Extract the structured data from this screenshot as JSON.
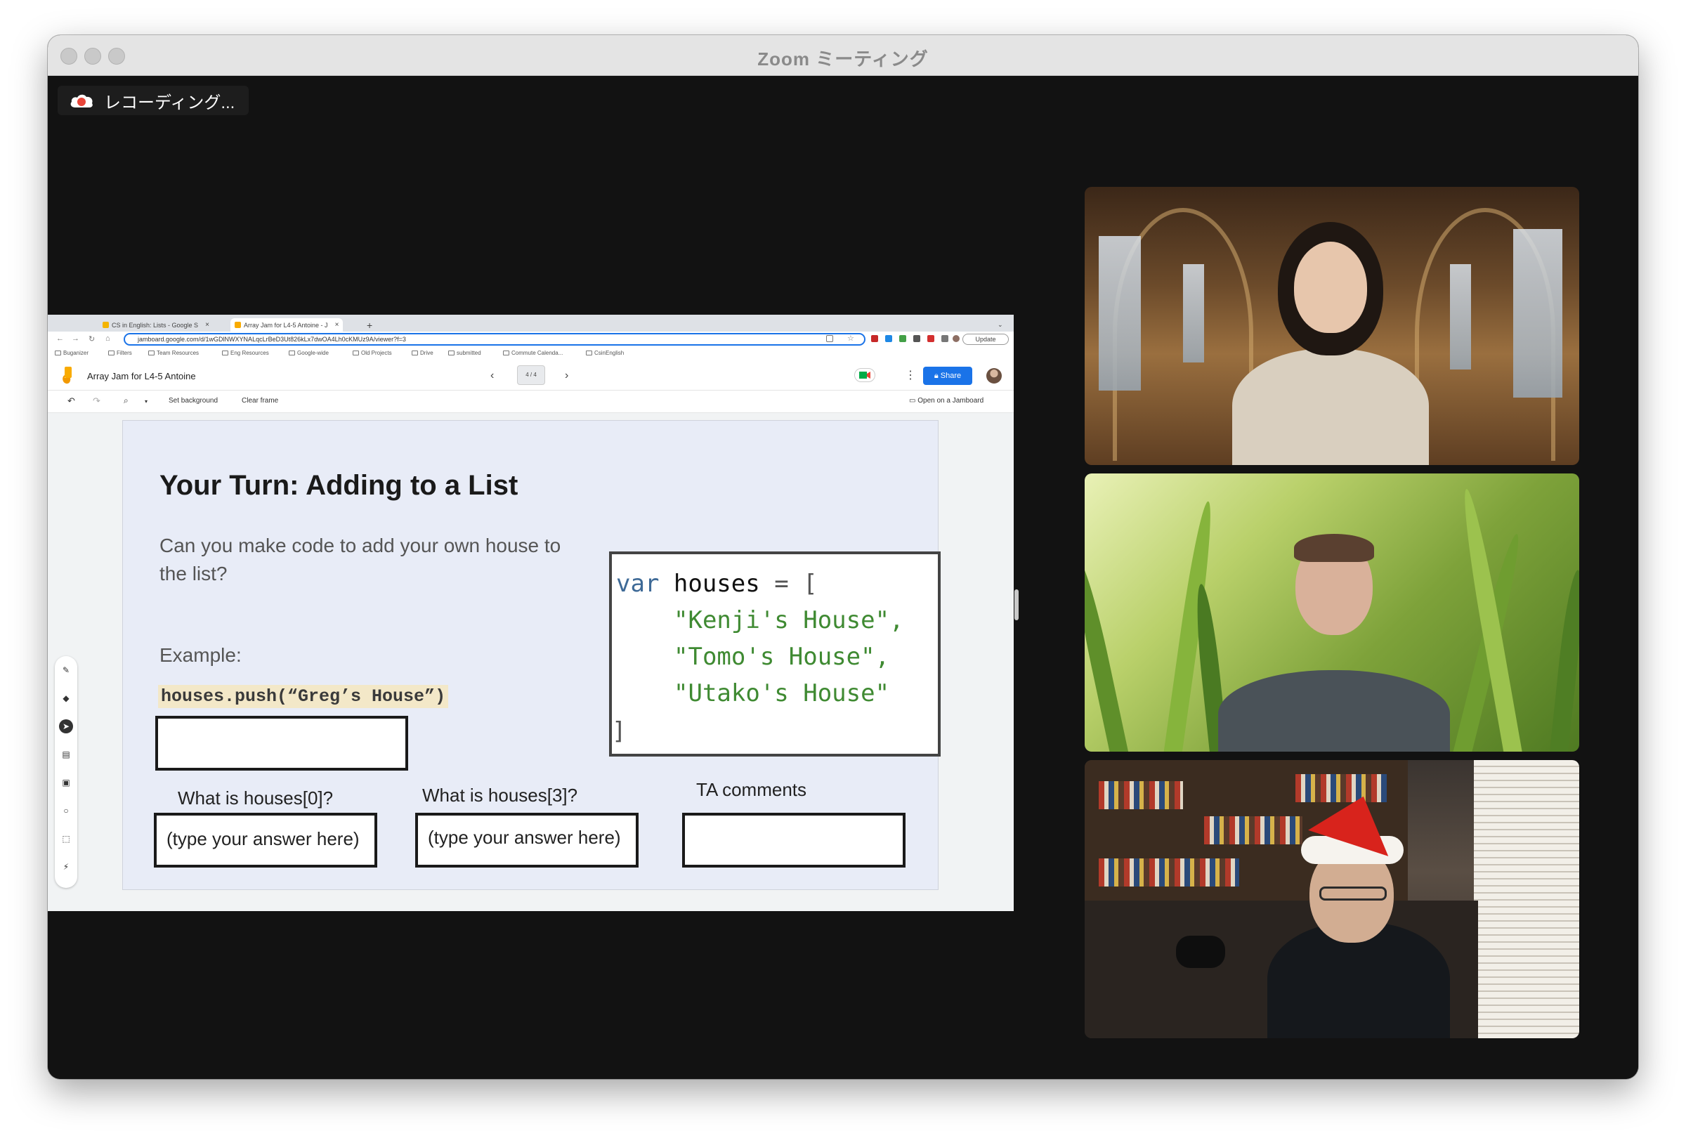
{
  "window": {
    "title": "Zoom ミーティング"
  },
  "recording": {
    "label": "レコーディング..."
  },
  "browser": {
    "tabs": [
      {
        "label": "CS in English: Lists - Google S",
        "active": false
      },
      {
        "label": "Array Jam for L4-5 Antoine - J",
        "active": true
      }
    ],
    "url": "jamboard.google.com/d/1wGDlNWXYNALqcLrBeD3Ut826kLx7dwOA4Lh0cKMUz9A/viewer?f=3",
    "update_label": "Update",
    "bookmarks": [
      "Buganizer",
      "Filters",
      "Team Resources",
      "Eng Resources",
      "Google-wide",
      "Old Projects",
      "Drive",
      "submitted",
      "Commute Calenda...",
      "CsinEnglish"
    ]
  },
  "jamboard": {
    "title": "Array Jam for L4-5 Antoine",
    "frame_indicator": "4 / 4",
    "share_label": "Share",
    "toolbar": {
      "set_background": "Set background",
      "clear_frame": "Clear frame",
      "open_on_jamboard": "Open on a Jamboard"
    },
    "tools": [
      "pen-icon",
      "eraser-icon",
      "select-icon",
      "sticky-note-icon",
      "image-icon",
      "circle-icon",
      "text-box-icon",
      "laser-icon"
    ]
  },
  "slide": {
    "title": "Your Turn: Adding to a List",
    "question": "Can you make code to add your own house to the list?",
    "example_label": "Example:",
    "example_code": "houses.push(“Greg’s House”)",
    "code": {
      "line1_kw": "var",
      "line1_id": " houses ",
      "line1_op": "= [",
      "line2": "\"Kenji's House\",",
      "line3": "\"Tomo's House\",",
      "line4": "\"Utako's House\"",
      "line5": "]"
    },
    "q1_label": "What is houses[0]?",
    "q2_label": "What is houses[3]?",
    "q3_label": "TA comments",
    "q1_answer": "(type your answer here)",
    "q2_answer": "(type your answer here)"
  },
  "colors": {
    "accent": "#1a73e8",
    "recording_red": "#e8463a",
    "stage_bg": "#121212"
  }
}
